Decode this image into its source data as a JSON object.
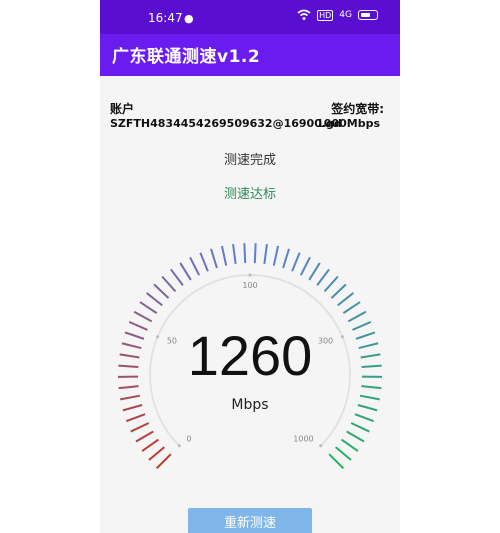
{
  "status_bar": {
    "time": "16:47",
    "wechat_icon": "wechat-icon",
    "hd": "HD",
    "cell": "4G"
  },
  "app": {
    "title": "广东联通测速v1.2"
  },
  "account": {
    "label": "账户",
    "value": "SZFTH4834454269509632@16900.gd"
  },
  "bandwidth": {
    "label": "签约宽带:",
    "value": "1000Mbps"
  },
  "test": {
    "status": "测速完成",
    "result": "测速达标",
    "result_color": "#2e8b57"
  },
  "gauge": {
    "speed": "1260",
    "unit": "Mbps",
    "scale_labels": [
      "0",
      "50",
      "100",
      "300",
      "1000"
    ],
    "colors": {
      "start": "#c0392b",
      "mid": "#5b7fd6",
      "end": "#27ae60"
    }
  },
  "retest_button": {
    "label": "重新测速",
    "color": "#7fb6ea"
  },
  "theme": {
    "primary": "#6a1bf0",
    "primary_dark": "#5a0fd0"
  }
}
